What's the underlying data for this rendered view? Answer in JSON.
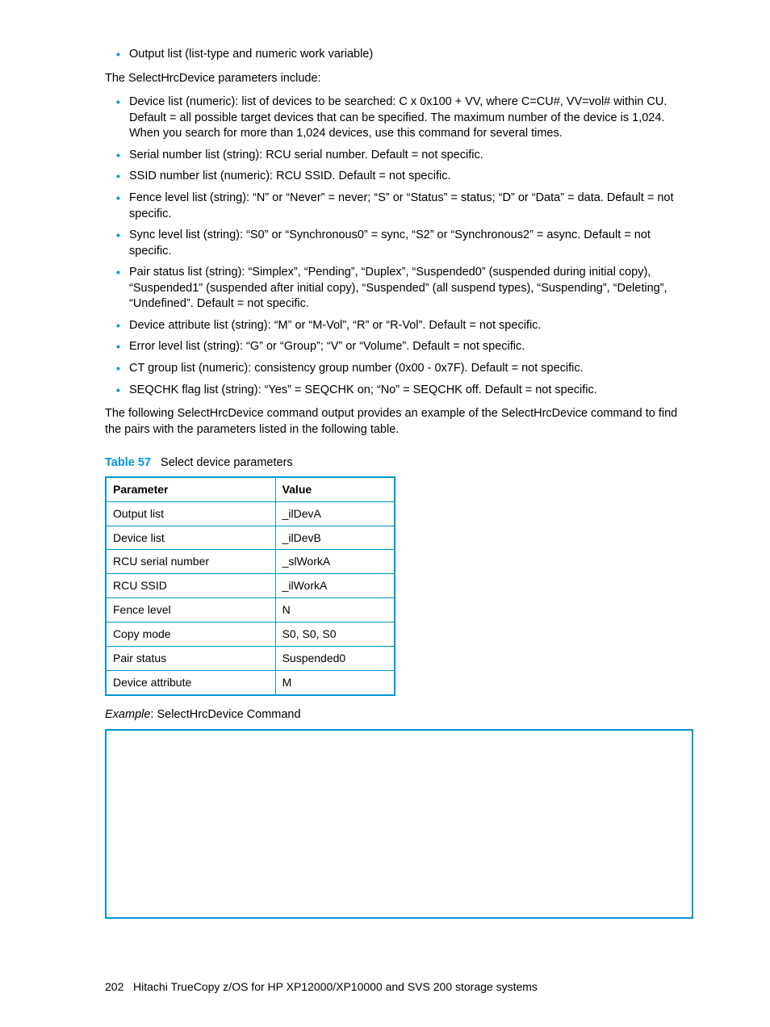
{
  "bullets_a": [
    "Output list (list-type and numeric work variable)"
  ],
  "intro_para": "The SelectHrcDevice parameters include:",
  "bullets_b": [
    "Device list (numeric): list of devices to be searched: C x 0x100 + VV, where C=CU#, VV=vol# within CU. Default = all possible target devices that can be specified. The maximum number of the device is 1,024. When you search for more than 1,024 devices, use this command for several times.",
    "Serial number list (string): RCU serial number. Default = not specific.",
    "SSID number list (numeric): RCU SSID. Default = not specific.",
    "Fence level list (string): “N” or “Never” = never; “S” or “Status” = status; “D” or “Data” = data. Default = not specific.",
    "Sync level list (string): “S0” or “Synchronous0” = sync, “S2” or “Synchronous2” = async. Default = not specific.",
    "Pair status list (string): “Simplex”, “Pending”, “Duplex”, “Suspended0” (suspended during initial copy), “Suspended1” (suspended after initial copy), “Suspended” (all suspend types), “Suspending”, “Deleting”, “Undefined”. Default = not specific.",
    "Device attribute list (string): “M” or “M-Vol”, “R” or “R-Vol”. Default = not specific.",
    "Error level list (string): “G” or “Group”; “V” or “Volume”. Default = not specific.",
    "CT group list (numeric): consistency group number (0x00 - 0x7F). Default = not specific.",
    "SEQCHK flag list (string): “Yes” = SEQCHK on; “No” = SEQCHK off. Default = not specific."
  ],
  "outro_para": "The following SelectHrcDevice command output provides an example of the SelectHrcDevice command to find the pairs with the parameters listed in the following table.",
  "table": {
    "label_num": "Table 57",
    "label_text": "Select device parameters",
    "head_param": "Parameter",
    "head_value": "Value",
    "rows": [
      {
        "p": "Output list",
        "v": "_ilDevA"
      },
      {
        "p": "Device list",
        "v": "_ilDevB"
      },
      {
        "p": "RCU serial number",
        "v": "_slWorkA"
      },
      {
        "p": "RCU SSID",
        "v": "_ilWorkA"
      },
      {
        "p": "Fence level",
        "v": "N"
      },
      {
        "p": "Copy mode",
        "v": "S0, S0, S0"
      },
      {
        "p": "Pair status",
        "v": "Suspended0"
      },
      {
        "p": "Device attribute",
        "v": "M"
      }
    ]
  },
  "example_label_em": "Example",
  "example_label_rest": ": SelectHrcDevice Command",
  "footer": {
    "pagenum": "202",
    "text": "Hitachi TrueCopy z/OS for HP XP12000/XP10000 and SVS 200 storage systems"
  }
}
